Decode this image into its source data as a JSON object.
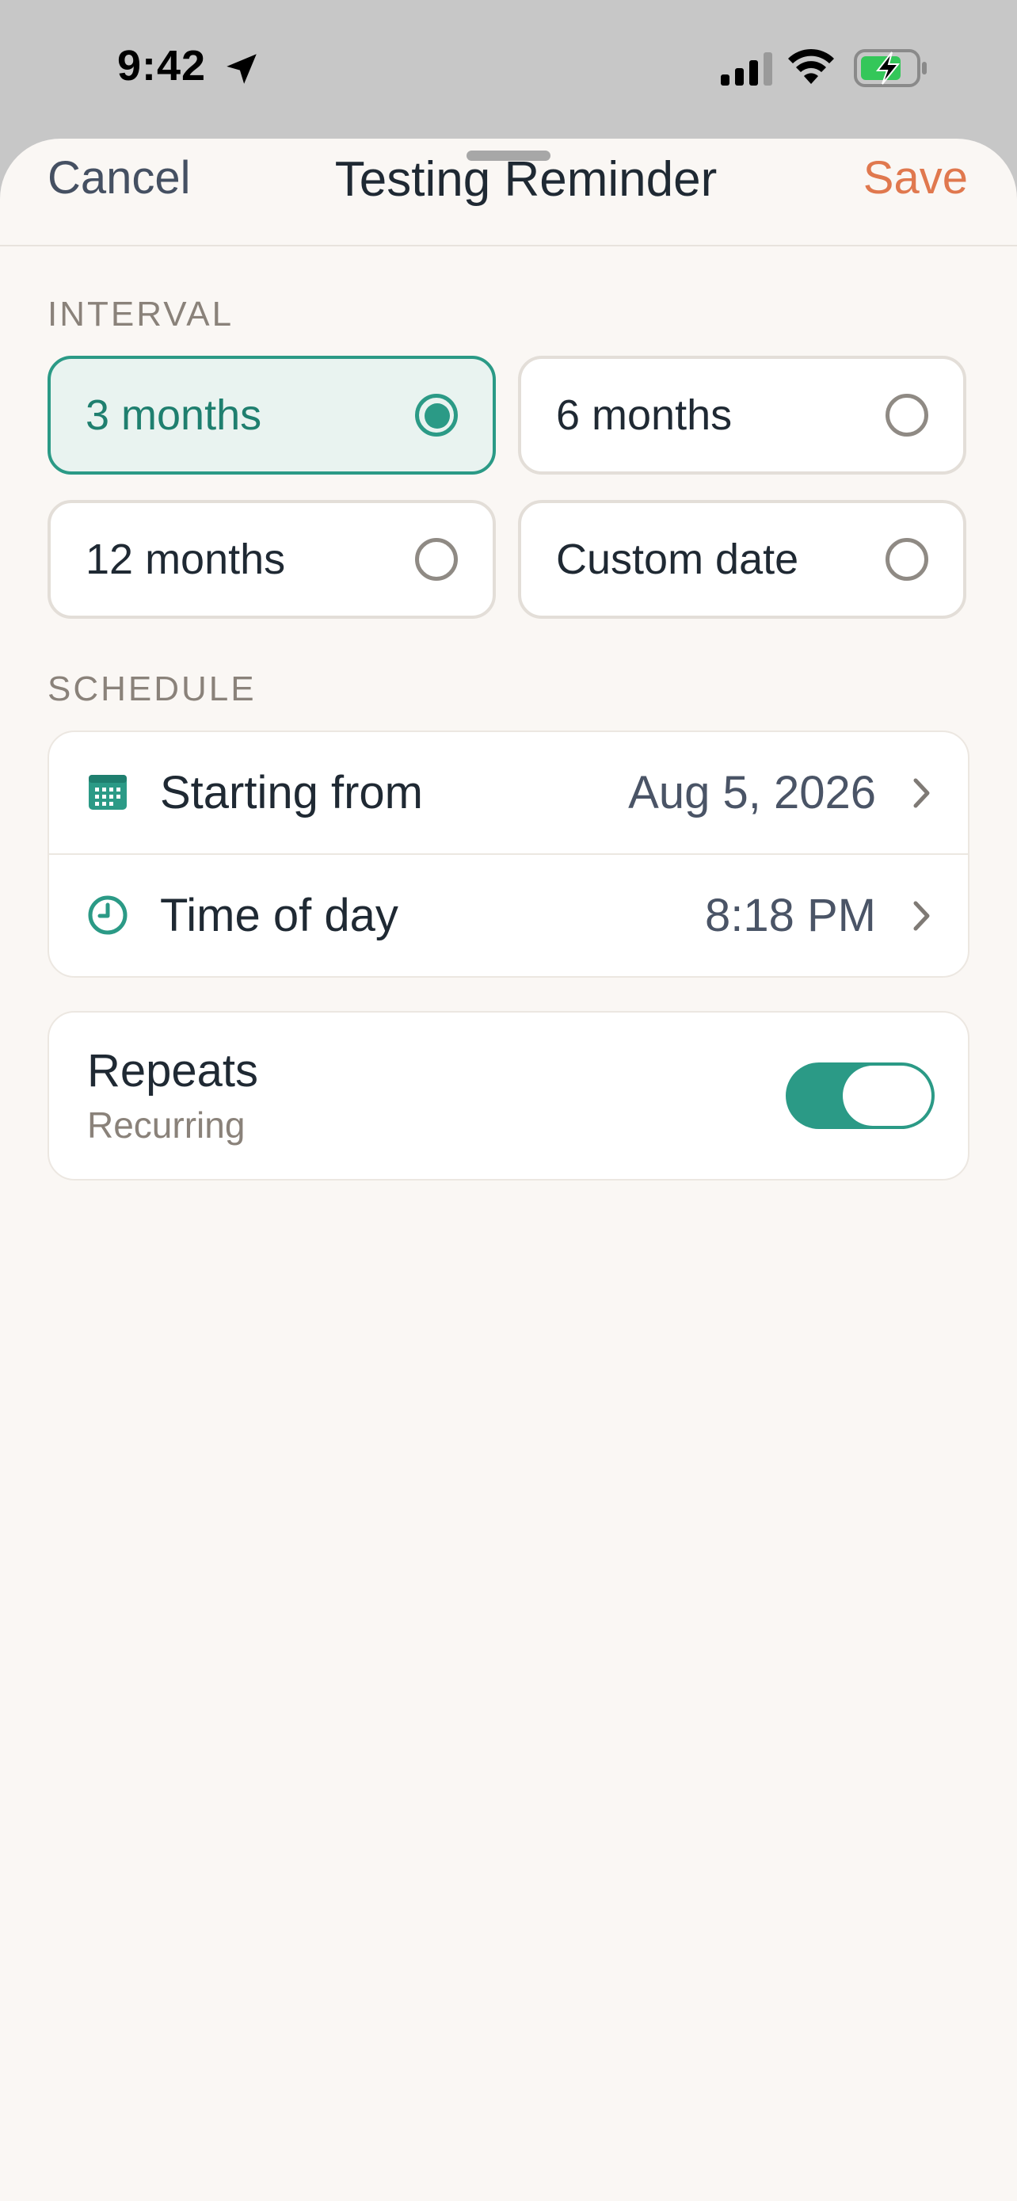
{
  "status_bar": {
    "time": "9:42"
  },
  "header": {
    "cancel_label": "Cancel",
    "title": "Testing Reminder",
    "save_label": "Save"
  },
  "interval": {
    "section_label": "INTERVAL",
    "options": [
      {
        "label": "3 months",
        "selected": true
      },
      {
        "label": "6 months",
        "selected": false
      },
      {
        "label": "12 months",
        "selected": false
      },
      {
        "label": "Custom date",
        "selected": false
      }
    ]
  },
  "schedule": {
    "section_label": "SCHEDULE",
    "rows": [
      {
        "label": "Starting from",
        "value": "Aug 5, 2026",
        "icon": "calendar-icon"
      },
      {
        "label": "Time of day",
        "value": "8:18 PM",
        "icon": "clock-icon"
      }
    ]
  },
  "repeats": {
    "title": "Repeats",
    "subtitle": "Recurring",
    "enabled": true
  },
  "colors": {
    "accent": "#2b9a86",
    "save": "#e0784e",
    "sheet_background": "#faf7f4"
  }
}
